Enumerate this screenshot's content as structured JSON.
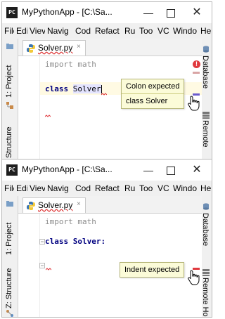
{
  "app": {
    "title": "MyPythonApp - [C:\\Sa...",
    "icon_label": "PC"
  },
  "window_controls": {
    "minimize": "—",
    "close": "✕"
  },
  "menu": [
    "File",
    "Edit",
    "View",
    "Navigate",
    "Code",
    "Refactor",
    "Run",
    "Tools",
    "VCS",
    "Window",
    "Help"
  ],
  "menu_visible": [
    "File",
    "Edi",
    "Viev",
    "Navig",
    "Cod",
    "Refact",
    "Ru",
    "Too",
    "VC",
    "Windo",
    "Hel"
  ],
  "file_tab": {
    "name": "Solver.py",
    "close": "×"
  },
  "left_tool_windows": {
    "project": "1: Project",
    "structure_top": "Structure",
    "structure_bottom": "Z: Structure"
  },
  "right_tool_windows": {
    "database": "Database",
    "remote_top": "Remote",
    "remote_bottom": "Remote Host"
  },
  "screen1": {
    "line1": "import math",
    "line2_kw": "class",
    "line2_ident": "Solver",
    "error_badge": "!",
    "tooltip": [
      "Colon expected",
      "class Solver"
    ]
  },
  "screen2": {
    "line1": "import math",
    "line2": "class Solver:",
    "tooltip": [
      "Indent expected"
    ]
  },
  "colors": {
    "error": "#e0393e",
    "tooltip_bg": "#fbfbd8",
    "current_line": "#fffae3",
    "keyword": "#000080"
  }
}
